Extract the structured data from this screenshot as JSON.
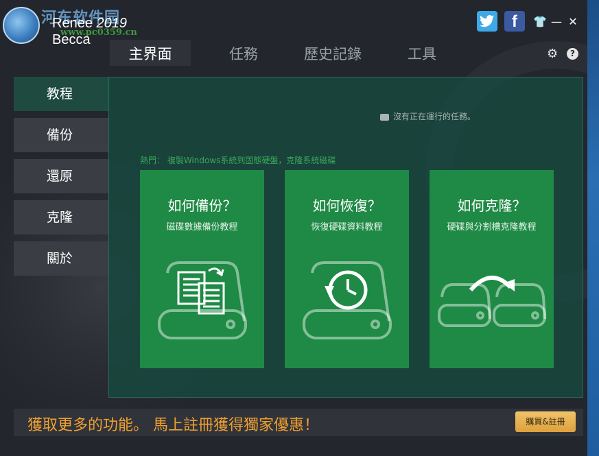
{
  "watermark": {
    "title": "河东软件园",
    "url": "www.pc0359.cn"
  },
  "brand": {
    "name": "Renee",
    "year": "2019",
    "product": "Becca"
  },
  "tabs": [
    "主界面",
    "任務",
    "歷史記錄",
    "工具"
  ],
  "sidebar": {
    "items": [
      {
        "label": "教程"
      },
      {
        "label": "備份"
      },
      {
        "label": "還原"
      },
      {
        "label": "克隆"
      },
      {
        "label": "關於"
      }
    ]
  },
  "panel": {
    "status": "沒有正在運行的任務。",
    "hot": "熱門： 複製Windows系統到固態硬盤，克隆系統磁碟",
    "cards": [
      {
        "title": "如何備份？",
        "subtitle": "磁碟數據備份教程",
        "icon": "backup-documents-icon"
      },
      {
        "title": "如何恢復？",
        "subtitle": "恢復硬碟資料教程",
        "icon": "restore-clock-icon"
      },
      {
        "title": "如何克隆？",
        "subtitle": "硬碟與分割槽克隆教程",
        "icon": "clone-disks-icon"
      }
    ]
  },
  "footer": {
    "promo": "獲取更多的功能。 馬上註冊獲得獨家優惠！",
    "buy_label": "購買&註冊"
  },
  "colors": {
    "accent_green": "#1f8a45",
    "promo_orange": "#f0a030",
    "panel_bg": "#18483e"
  }
}
